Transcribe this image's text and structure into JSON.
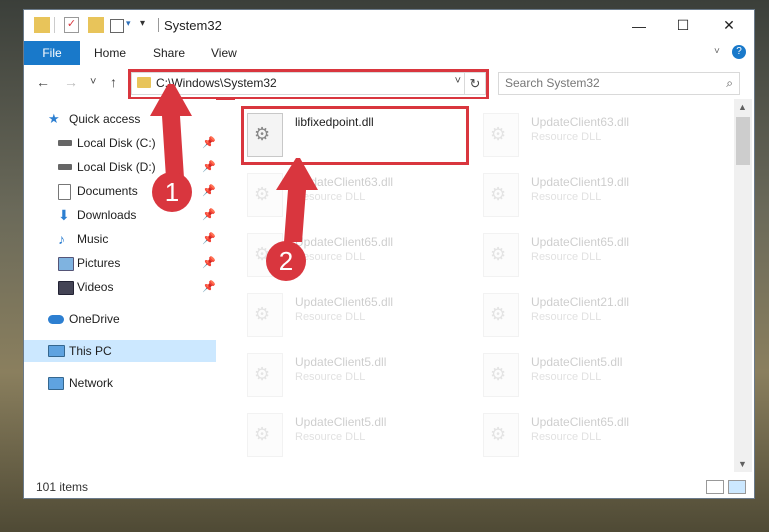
{
  "window": {
    "title": "System32",
    "controls": {
      "minimize": "—",
      "maximize": "☐",
      "close": "✕"
    }
  },
  "ribbon": {
    "tabs": [
      "File",
      "Home",
      "Share",
      "View"
    ],
    "expand_icon": "chevron-down-icon",
    "help_icon": "?"
  },
  "nav": {
    "back": "←",
    "forward": "→",
    "recent": "˅",
    "up": "↑",
    "address": "C:\\Windows\\System32",
    "address_drop": "˅",
    "refresh": "↻",
    "search_placeholder": "Search System32",
    "search_icon": "⌕"
  },
  "sidebar": {
    "items": [
      {
        "label": "Quick access",
        "icon": "star-icon",
        "pinned": false
      },
      {
        "label": "Local Disk (C:)",
        "icon": "drive-icon",
        "pinned": true
      },
      {
        "label": "Local Disk (D:)",
        "icon": "drive-icon",
        "pinned": true
      },
      {
        "label": "Documents",
        "icon": "documents-icon",
        "pinned": true
      },
      {
        "label": "Downloads",
        "icon": "downloads-icon",
        "pinned": true
      },
      {
        "label": "Music",
        "icon": "music-icon",
        "pinned": true
      },
      {
        "label": "Pictures",
        "icon": "pictures-icon",
        "pinned": true
      },
      {
        "label": "Videos",
        "icon": "videos-icon",
        "pinned": true
      },
      {
        "label": "OneDrive",
        "icon": "cloud-icon",
        "pinned": false
      },
      {
        "label": "This PC",
        "icon": "computer-icon",
        "pinned": false,
        "selected": true
      },
      {
        "label": "Network",
        "icon": "network-icon",
        "pinned": false
      }
    ],
    "pin_glyph": "📌"
  },
  "files": {
    "left": [
      {
        "name": "libfixedpoint.dll",
        "type": ""
      },
      {
        "name": "UpdateClient63.dll",
        "type": "Resource DLL"
      },
      {
        "name": "UpdateClient65.dll",
        "type": "Resource DLL"
      },
      {
        "name": "UpdateClient65.dll",
        "type": "Resource DLL"
      },
      {
        "name": "UpdateClient5.dll",
        "type": "Resource DLL"
      },
      {
        "name": "UpdateClient5.dll",
        "type": "Resource DLL"
      }
    ],
    "right": [
      {
        "name": "UpdateClient63.dll",
        "type": "Resource DLL"
      },
      {
        "name": "UpdateClient19.dll",
        "type": "Resource DLL"
      },
      {
        "name": "UpdateClient65.dll",
        "type": "Resource DLL"
      },
      {
        "name": "UpdateClient21.dll",
        "type": "Resource DLL"
      },
      {
        "name": "UpdateClient5.dll",
        "type": "Resource DLL"
      },
      {
        "name": "UpdateClient65.dll",
        "type": "Resource DLL"
      }
    ]
  },
  "status": {
    "count": "101 items"
  },
  "annotations": {
    "step1": "1",
    "step2": "2",
    "color": "#d9363e"
  }
}
